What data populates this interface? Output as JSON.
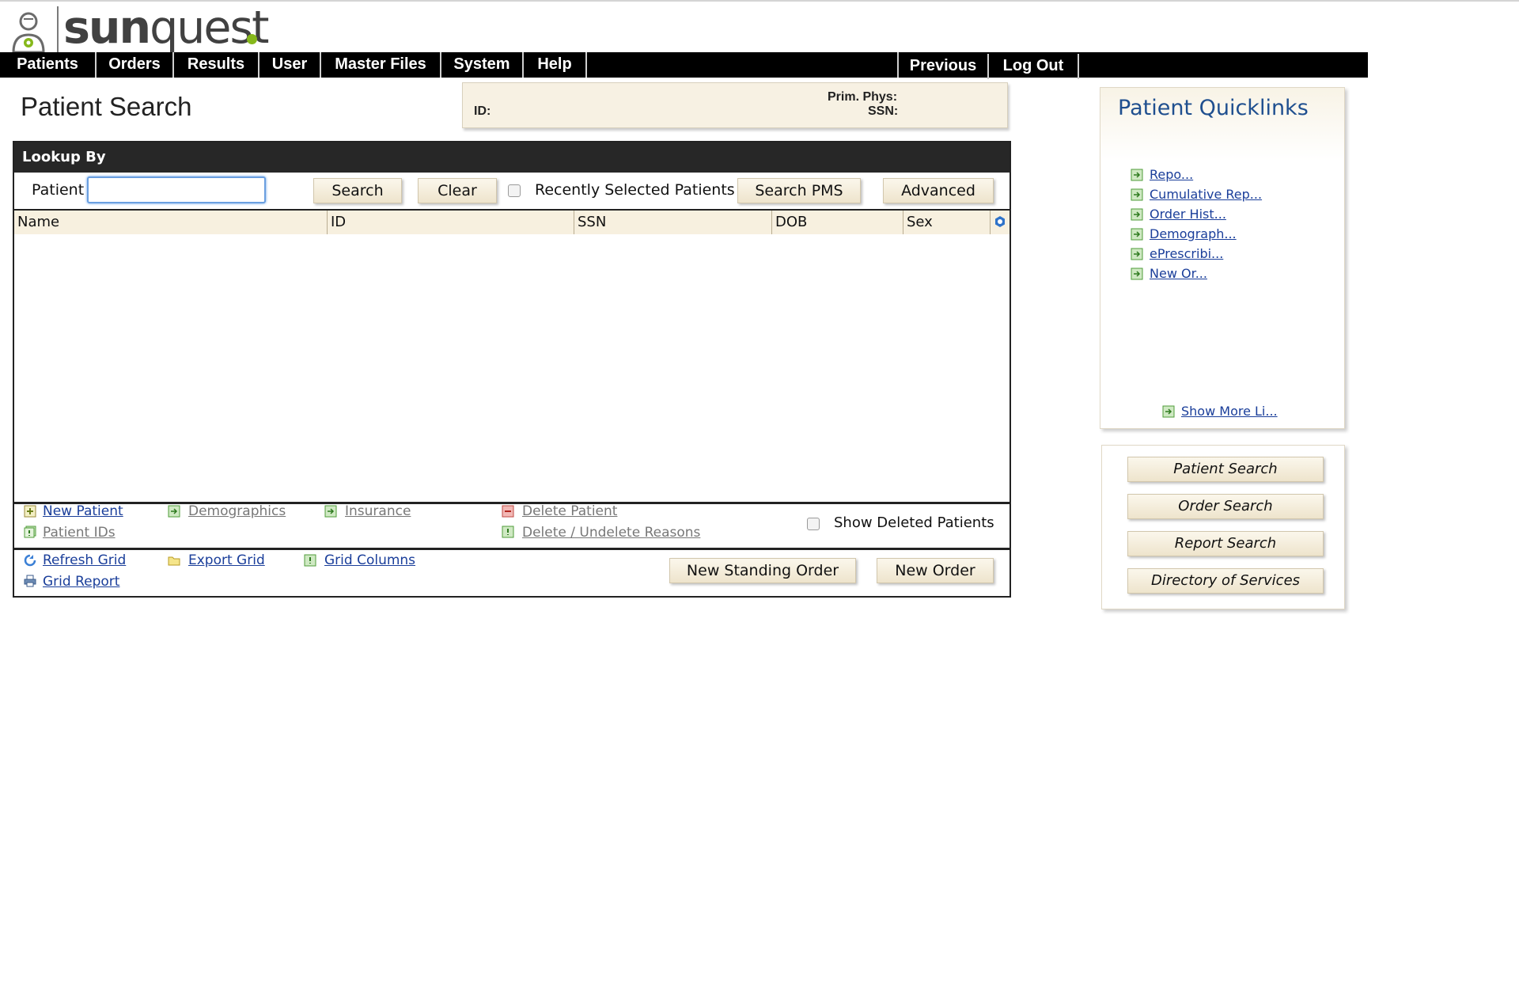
{
  "logo": {
    "brand_regular": "sun",
    "brand_light": "quest",
    "accent": "#86b81b"
  },
  "menu": {
    "items": [
      "Patients",
      "Orders",
      "Results",
      "User",
      "Master Files",
      "System",
      "Help"
    ],
    "right_items": [
      "Previous",
      "Log Out"
    ]
  },
  "page": {
    "title": "Patient Search"
  },
  "banner": {
    "prim_phys_label": "Prim. Phys:",
    "ssn_label": "SSN:",
    "id_label": "ID:"
  },
  "lookup": {
    "header": "Lookup By",
    "patient_label": "Patient",
    "patient_value": "",
    "search_button": "Search",
    "clear_button": "Clear",
    "recent_label": "Recently Selected Patients",
    "search_pms_button": "Search PMS",
    "advanced_button": "Advanced"
  },
  "grid": {
    "columns": [
      "Name",
      "ID",
      "SSN",
      "DOB",
      "Sex"
    ],
    "rows": []
  },
  "actions": {
    "new_patient": "New Patient",
    "patient_ids": "Patient IDs",
    "demographics": "Demographics",
    "insurance": "Insurance",
    "delete_patient": "Delete Patient",
    "delete_reasons": "Delete / Undelete Reasons",
    "show_deleted": "Show Deleted Patients",
    "refresh_grid": "Refresh Grid",
    "grid_report": "Grid Report",
    "export_grid": "Export Grid",
    "grid_columns": "Grid Columns",
    "new_standing_order": "New Standing Order",
    "new_order": "New Order"
  },
  "quicklinks": {
    "title": "Patient Quicklinks",
    "items": [
      "Repo...",
      "Cumulative Rep...",
      "Order Hist...",
      "Demograph...",
      "ePrescribi...",
      "New Or..."
    ],
    "show_more": "Show More Li..."
  },
  "nav_buttons": [
    "Patient Search",
    "Order Search",
    "Report Search",
    "Directory of Services"
  ],
  "colors": {
    "menu_bg": "#000000",
    "button_bg": "#f3ead4",
    "link": "#1a3e9a",
    "quick_title": "#1f4f8f"
  }
}
